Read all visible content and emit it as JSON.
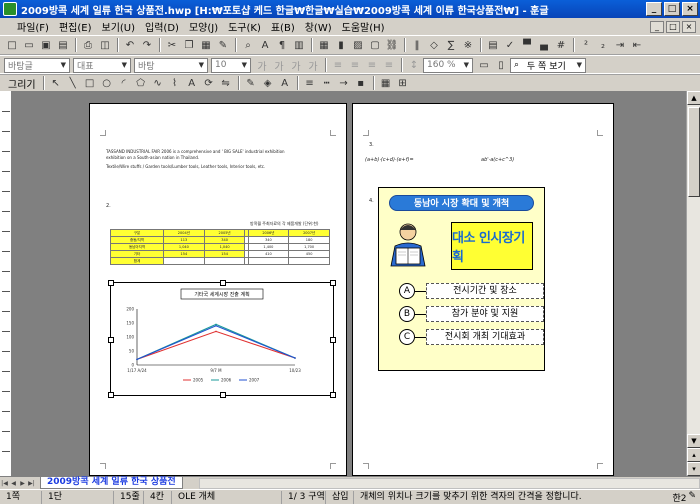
{
  "window": {
    "title": "2009방콕 세계 일류 한국 상품전.hwp [H:₩포토샵 케드 한글₩한글₩실습₩2009방콕 세계 이류 한국상품전₩] - 훈글",
    "controls": [
      "_",
      "□",
      "×"
    ]
  },
  "menu": {
    "items": [
      "파일(F)",
      "편집(E)",
      "보기(U)",
      "입력(D)",
      "모양(J)",
      "도구(K)",
      "표(B)",
      "창(W)",
      "도움말(H)"
    ],
    "mdi": [
      "_",
      "□",
      "×"
    ]
  },
  "toolbar2": {
    "style_combo": "바탕글",
    "style2_combo": "대표",
    "font_combo": "바탕",
    "size_combo": "10",
    "zoom_combo": "160 %",
    "view_combo": "두 쪽 보기"
  },
  "toolbar3": {
    "draw_label": "그리기"
  },
  "left_page": {
    "para1_line1": "TASSAND INDUSTRIAL FAIR 2006 is a comprehensive and ' BIG SALE' industrial exhibition",
    "para1_line2": "exhibition on a South-asian nation in Thailand.",
    "para2": "Textile/Wire stuffs / Garden tools/Lumber tools, Leather tools, Interior tools, etc.",
    "section_num": "2.",
    "table_caption": "방콕월 주최자료의 각 제품개발 (단위:천)",
    "table": {
      "header": [
        "구분",
        "2004년",
        "2005년",
        "",
        "2006년",
        "2007년"
      ],
      "rows": [
        [
          "중동/지역",
          "113",
          "340",
          "",
          "340",
          "180"
        ],
        [
          "동남아지역",
          "1,040",
          "1,040",
          "",
          "1,400",
          "1,700"
        ],
        [
          "기타",
          "154",
          "154",
          "",
          "410",
          "450"
        ],
        [
          "합계",
          "",
          "",
          "",
          "",
          ""
        ]
      ]
    },
    "chart_title": "기타국 세계시장 진출 계획"
  },
  "chart_data": {
    "type": "line",
    "title": "기타국 세계시장 진출 계획",
    "categories": [
      "1/17 A/24",
      "9/7 M",
      "10/23"
    ],
    "ylim": [
      0,
      200
    ],
    "yticks": [
      0,
      50,
      100,
      150,
      200
    ],
    "series": [
      {
        "name": "2005",
        "color": "#e03030",
        "values": [
          20,
          120,
          25
        ]
      },
      {
        "name": "2006",
        "color": "#1a9a9a",
        "values": [
          20,
          145,
          25
        ]
      },
      {
        "name": "2007",
        "color": "#2050d0",
        "values": [
          20,
          140,
          25
        ]
      }
    ]
  },
  "right_page": {
    "section3": "3.",
    "formula_left": "(a+b)·(c+d)·(e+f)=",
    "formula_right": "ab'·a(c+c^3)",
    "section4": "4.",
    "banner": "동남아 시장 확대 및 개척",
    "promo_title": "대소 인시장기획",
    "items": [
      {
        "letter": "A",
        "text": "전시기간 및 장소"
      },
      {
        "letter": "B",
        "text": "참가 분야 및 지원"
      },
      {
        "letter": "C",
        "text": "전시회 개최 기대효과"
      }
    ]
  },
  "tabbar": {
    "doc_tab": "2009방콕 세계 일류 한국 상품전"
  },
  "status": {
    "page": "1쪽",
    "column": "1단",
    "line": "15줄",
    "col_pos": "4칸",
    "object": "OLE 개체",
    "section": "1/  3 구역",
    "mode": "삽입",
    "message": "개체의 위치나 크기를 맞추기 위한 격자의 간격을 정합니다.",
    "ime": "한2"
  }
}
